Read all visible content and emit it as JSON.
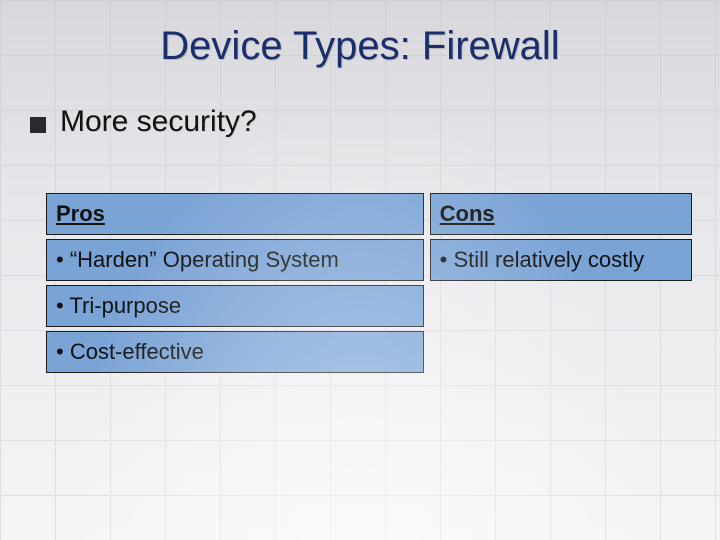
{
  "title": "Device Types: Firewall",
  "subtitle": "More security?",
  "pros": {
    "header": "Pros",
    "items": [
      "• “Harden” Operating System",
      "• Tri-purpose",
      "• Cost-effective"
    ]
  },
  "cons": {
    "header": "Cons",
    "items": [
      "• Still relatively costly"
    ]
  }
}
